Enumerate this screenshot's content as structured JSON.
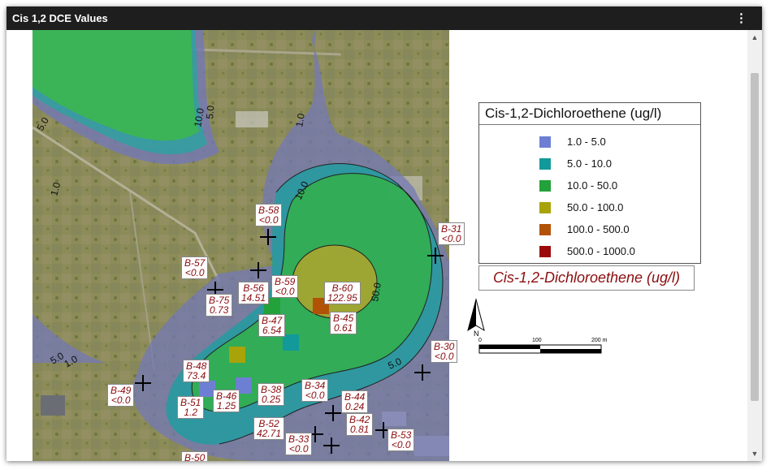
{
  "window": {
    "title": "Cis 1,2 DCE Values",
    "menu_icon": "kebab-menu-icon"
  },
  "scroll": {
    "up_icon": "arrow-up-icon",
    "down_icon": "arrow-down-icon"
  },
  "legend": {
    "title": "Cis-1,2-Dichloroethene (ug/l)",
    "items": [
      {
        "label": "1.0 - 5.0",
        "color": "#6d7fd3"
      },
      {
        "label": "5.0 - 10.0",
        "color": "#12999a"
      },
      {
        "label": "10.0 - 50.0",
        "color": "#23a13a"
      },
      {
        "label": "50.0 - 100.0",
        "color": "#a8a309"
      },
      {
        "label": "100.0 - 500.0",
        "color": "#b25206"
      },
      {
        "label": "500.0 - 1000.0",
        "color": "#9b0b0b"
      }
    ]
  },
  "map_title": "Cis-1,2-Dichloroethene (ug/l)",
  "north_arrow": {
    "letter": "N"
  },
  "scale": {
    "labels": [
      "0",
      "100",
      "200 m"
    ]
  },
  "contours": [
    "5.0",
    "10.0",
    "5.0",
    "1.0",
    "1.0",
    "10.0",
    "50.0",
    "5.0",
    "5.0",
    "1.0"
  ],
  "samples": [
    {
      "id": "B-58",
      "value": "<0.0"
    },
    {
      "id": "B-31",
      "value": "<0.0"
    },
    {
      "id": "B-57",
      "value": "<0.0"
    },
    {
      "id": "B-59",
      "value": "<0.0"
    },
    {
      "id": "B-56",
      "value": "14.51"
    },
    {
      "id": "B-75",
      "value": "0.73"
    },
    {
      "id": "B-60",
      "value": "122.95"
    },
    {
      "id": "B-47",
      "value": "6.54"
    },
    {
      "id": "B-45",
      "value": "0.61"
    },
    {
      "id": "B-30",
      "value": "<0.0"
    },
    {
      "id": "B-48",
      "value": "73.4"
    },
    {
      "id": "B-49",
      "value": "<0.0"
    },
    {
      "id": "B-51",
      "value": "1.2"
    },
    {
      "id": "B-46",
      "value": "1.25"
    },
    {
      "id": "B-38",
      "value": "0.25"
    },
    {
      "id": "B-34",
      "value": "<0.0"
    },
    {
      "id": "B-44",
      "value": "0.24"
    },
    {
      "id": "B-42",
      "value": "0.81"
    },
    {
      "id": "B-52",
      "value": "42.71"
    },
    {
      "id": "B-33",
      "value": "<0.0"
    },
    {
      "id": "B-53",
      "value": "<0.0"
    },
    {
      "id": "B-50",
      "value": ""
    }
  ]
}
